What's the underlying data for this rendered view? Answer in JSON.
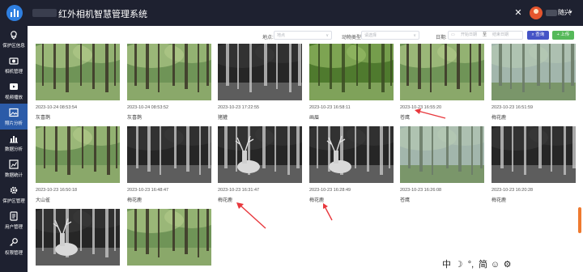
{
  "header": {
    "title": "红外相机智慧管理系统",
    "username": "随兴"
  },
  "sidebar": {
    "items": [
      {
        "label": "保护区信息",
        "icon": "map-pin-icon"
      },
      {
        "label": "相机管理",
        "icon": "camera-icon"
      },
      {
        "label": "视频播放",
        "icon": "video-icon"
      },
      {
        "label": "照片分析",
        "icon": "image-icon",
        "active": true
      },
      {
        "label": "数据分析",
        "icon": "bar-chart-icon"
      },
      {
        "label": "数据统计",
        "icon": "stats-icon"
      },
      {
        "label": "保护区管理",
        "icon": "gear-icon"
      },
      {
        "label": "用户管理",
        "icon": "user-icon"
      },
      {
        "label": "权限管理",
        "icon": "key-icon"
      }
    ]
  },
  "filters": {
    "location_label": "地点:",
    "location_placeholder": "地点",
    "animal_label": "动物类型:",
    "animal_placeholder": "请选择",
    "date_label": "日期:",
    "start_placeholder": "开始日期",
    "separator": "至",
    "end_placeholder": "结束日期",
    "search_button": "查询",
    "upload_button": "上传"
  },
  "photos": [
    {
      "timestamp": "2023-10-24 08:53:54",
      "species": "灰喜鹊",
      "scene": "day-forest"
    },
    {
      "timestamp": "2023-10-24 08:53:52",
      "species": "灰喜鹊",
      "scene": "day-forest"
    },
    {
      "timestamp": "2023-10-23 17:22:55",
      "species": "猪獾",
      "scene": "night"
    },
    {
      "timestamp": "2023-10-23 16:58:11",
      "species": "画眉",
      "scene": "day-dense"
    },
    {
      "timestamp": "2023-10-23 16:55:20",
      "species": "苍鹰",
      "scene": "day-forest"
    },
    {
      "timestamp": "2023-10-23 16:51:59",
      "species": "梅花鹿",
      "scene": "day-mist"
    },
    {
      "timestamp": "2023-10-23 16:50:18",
      "species": "大山雀",
      "scene": "day-forest"
    },
    {
      "timestamp": "2023-10-23 16:48:47",
      "species": "梅花鹿",
      "scene": "night"
    },
    {
      "timestamp": "2023-10-23 16:31:47",
      "species": "梅花鹿",
      "scene": "night-deer"
    },
    {
      "timestamp": "2023-10-23 16:28:49",
      "species": "梅花鹿",
      "scene": "night-deer"
    },
    {
      "timestamp": "2023-10-23 16:26:08",
      "species": "苍鹰",
      "scene": "day-mist"
    },
    {
      "timestamp": "2023-10-23 16:20:28",
      "species": "梅花鹿",
      "scene": "night"
    },
    {
      "timestamp": "",
      "species": "",
      "scene": "night-deer"
    },
    {
      "timestamp": "",
      "species": "",
      "scene": "day-forest"
    }
  ],
  "ime_toolbar": [
    "中",
    "☽",
    "°,",
    "简",
    "☺",
    "⚙"
  ],
  "colors": {
    "sidebar_bg": "#1e2130",
    "active_nav": "#2b5ba8",
    "search_button": "#4554c6",
    "upload_button": "#56b95a",
    "arrow": "#e8383d"
  }
}
